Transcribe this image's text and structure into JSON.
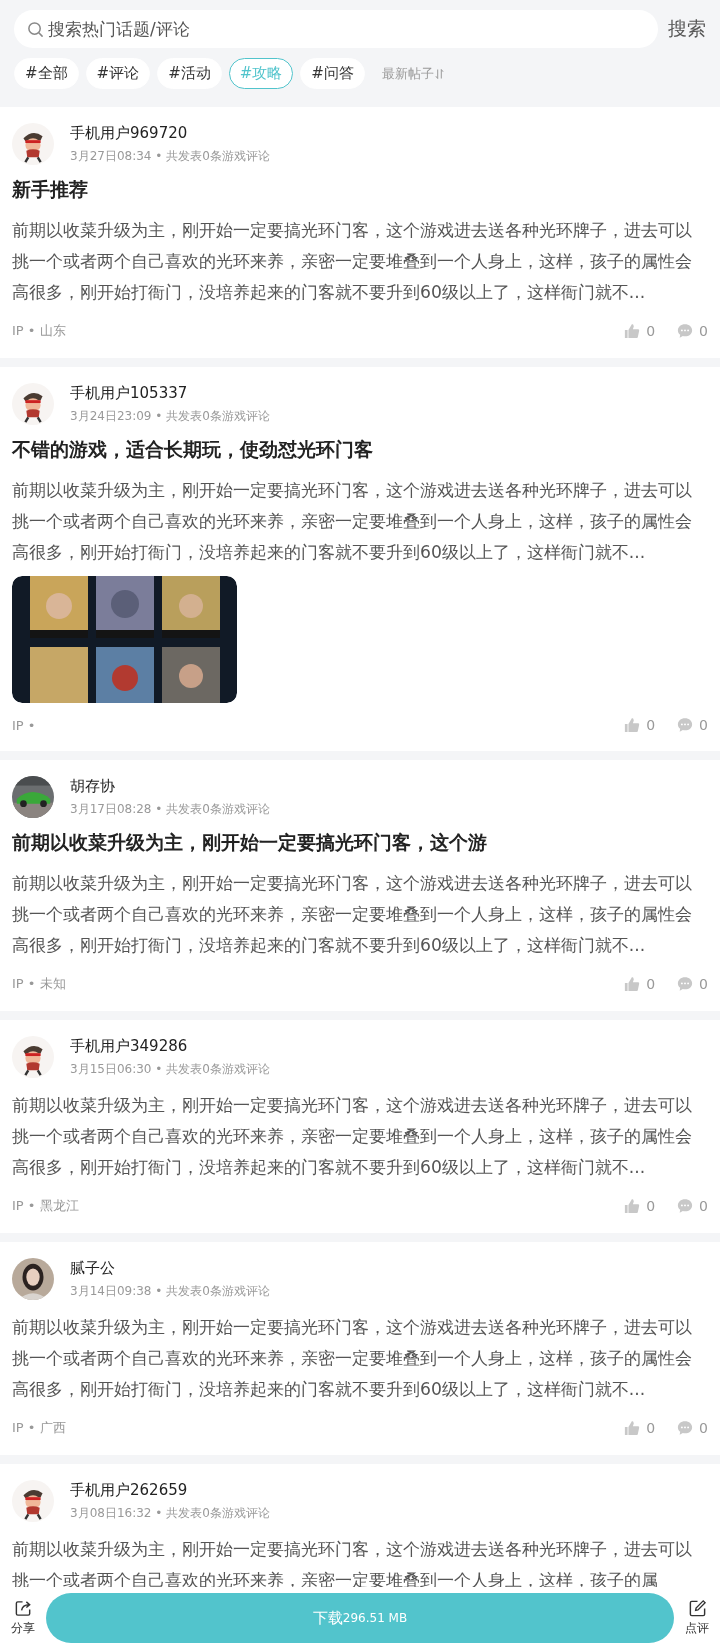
{
  "search": {
    "placeholder": "搜索热门话题/评论",
    "button": "搜索"
  },
  "tabs": [
    {
      "label": "#全部",
      "selected": false
    },
    {
      "label": "#评论",
      "selected": false
    },
    {
      "label": "#活动",
      "selected": false
    },
    {
      "label": "#攻略",
      "selected": true
    },
    {
      "label": "#问答",
      "selected": false
    }
  ],
  "sort": {
    "label": "最新帖子"
  },
  "posts": [
    {
      "avatar": {
        "kind": "cartoon"
      },
      "user": "手机用户969720",
      "meta": "3月27日08:34 • 共发表0条游戏评论",
      "title": "新手推荐",
      "body": "前期以收菜升级为主，刚开始一定要搞光环门客，这个游戏进去送各种光环牌子，进去可以挑一个或者两个自己喜欢的光环来养，亲密一定要堆叠到一个人身上，这样，孩子的属性会高很多，刚开始打衙门，没培养起来的门客就不要升到60级以上了，这样衙门就不...",
      "location": "IP • 山东",
      "likes": "0",
      "comments": "0"
    },
    {
      "avatar": {
        "kind": "cartoon"
      },
      "user": "手机用户105337",
      "meta": "3月24日23:09 • 共发表0条游戏评论",
      "title": "不错的游戏，适合长期玩，使劲怼光环门客",
      "body": "前期以收菜升级为主，刚开始一定要搞光环门客，这个游戏进去送各种光环牌子，进去可以挑一个或者两个自己喜欢的光环来养，亲密一定要堆叠到一个人身上，这样，孩子的属性会高很多，刚开始打衙门，没培养起来的门客就不要升到60级以上了，这样衙门就不...",
      "location": "IP •",
      "likes": "0",
      "comments": "0"
    },
    {
      "user": "胡存协",
      "meta": "3月17日08:28 • 共发表0条游戏评论",
      "title": "前期以收菜升级为主，刚开始一定要搞光环门客，这个游",
      "body": "前期以收菜升级为主，刚开始一定要搞光环门客，这个游戏进去送各种光环牌子，进去可以挑一个或者两个自己喜欢的光环来养，亲密一定要堆叠到一个人身上，这样，孩子的属性会高很多，刚开始打衙门，没培养起来的门客就不要升到60级以上了，这样衙门就不...",
      "location": "IP • 未知",
      "likes": "0",
      "comments": "0"
    },
    {
      "avatar": {
        "kind": "cartoon"
      },
      "user": "手机用户349286",
      "meta": "3月15日06:30 • 共发表0条游戏评论",
      "body": "前期以收菜升级为主，刚开始一定要搞光环门客，这个游戏进去送各种光环牌子，进去可以挑一个或者两个自己喜欢的光环来养，亲密一定要堆叠到一个人身上，这样，孩子的属性会高很多，刚开始打衙门，没培养起来的门客就不要升到60级以上了，这样衙门就不...",
      "location": "IP • 黑龙江",
      "likes": "0",
      "comments": "0"
    },
    {
      "avatar": {
        "kind": "person"
      },
      "user": "腻子公",
      "meta": "3月14日09:38 • 共发表0条游戏评论",
      "body": "前期以收菜升级为主，刚开始一定要搞光环门客，这个游戏进去送各种光环牌子，进去可以挑一个或者两个自己喜欢的光环来养，亲密一定要堆叠到一个人身上，这样，孩子的属性会高很多，刚开始打衙门，没培养起来的门客就不要升到60级以上了，这样衙门就不...",
      "location": "IP • 广西",
      "likes": "0",
      "comments": "0"
    },
    {
      "avatar": {
        "kind": "cartoon"
      },
      "user": "手机用户262659",
      "meta": "3月08日16:32 • 共发表0条游戏评论",
      "body": "前期以收菜升级为主，刚开始一定要搞光环门客，这个游戏进去送各种光环牌子，进去可以挑一个或者两个自己喜欢的光环来养，亲密一定要堆叠到一个人身上，这样，孩子的属"
    }
  ],
  "bottom_bar": {
    "share": "分享",
    "download": {
      "label": "下载",
      "size": "296.51 MB"
    },
    "review": "点评"
  }
}
